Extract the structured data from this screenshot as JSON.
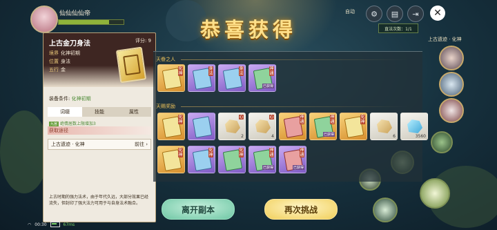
{
  "player": {
    "name": "仙仙仙仙帝",
    "hp_fraction": 0.78
  },
  "title": "恭喜获得",
  "topbar": {
    "auto": "自动",
    "speed": "直法次数：1/1",
    "location": "上古遗迹 · 化神"
  },
  "card": {
    "name": "上古金刀身法",
    "score": "评分: 9",
    "attributes": [
      {
        "key": "境界",
        "value": "化神初期"
      },
      {
        "key": "位置",
        "value": "身法"
      },
      {
        "key": "五行",
        "value": "金"
      }
    ],
    "equip_label": "装备条件:",
    "equip_value": "化神初期",
    "tabs": [
      "词缀",
      "技能",
      "属性"
    ],
    "bonus_tag": "九宫",
    "bonus_text": "绝情居数上限增加3",
    "obtain_label": "获取途径",
    "obtain_source": "上古遗迹 · 化神",
    "obtain_action": "前往",
    "description": "上古时期的强力法术，由于年代久远，大部分效果已经流失，但封印了强大法力可用于与自身法术融合。"
  },
  "rewards": {
    "section1": "天眷之人",
    "section2": "天赐奖励",
    "row1": [
      {
        "color": "gold",
        "book": "g",
        "tag": "化神",
        "count": ""
      },
      {
        "color": "purple",
        "book": "p",
        "tag": "身法",
        "count": ""
      },
      {
        "color": "purple",
        "book": "p",
        "tag": "身法",
        "count": ""
      },
      {
        "color": "purple",
        "book": "gr",
        "tag": "神通",
        "tag2": "已获得",
        "count": ""
      }
    ],
    "row2": [
      {
        "color": "gold",
        "book": "g",
        "tag": "化神",
        "count": ""
      },
      {
        "color": "purple",
        "book": "p",
        "tag": "",
        "count": ""
      },
      {
        "color": "white",
        "book": "",
        "tag": "心",
        "count": "2"
      },
      {
        "color": "white",
        "book": "",
        "tag": "心",
        "count": "4"
      },
      {
        "color": "gold",
        "book": "r",
        "tag": "神通",
        "count": ""
      },
      {
        "color": "gold",
        "book": "gr",
        "tag": "神通",
        "tag2": "已获得",
        "count": ""
      },
      {
        "color": "gold",
        "book": "g",
        "tag": "化神",
        "count": ""
      },
      {
        "color": "white",
        "book": "",
        "tag": "",
        "count": "6"
      },
      {
        "color": "white",
        "book": "",
        "tag": "",
        "count": "3560"
      }
    ],
    "row3": [
      {
        "color": "gold",
        "book": "g",
        "tag": "化神",
        "count": ""
      },
      {
        "color": "purple",
        "book": "p",
        "tag": "化神",
        "count": ""
      },
      {
        "color": "purple",
        "book": "gr",
        "tag": "化神",
        "count": ""
      },
      {
        "color": "purple",
        "book": "gr",
        "tag": "神通",
        "tag2": "已获得",
        "count": ""
      },
      {
        "color": "purple",
        "book": "r",
        "tag": "神通",
        "tag2": "已获得",
        "count": ""
      }
    ]
  },
  "buttons": {
    "leave": "离开副本",
    "again": "再次挑战"
  },
  "status": {
    "time": "00:30",
    "latency": "67ms"
  },
  "icons": {
    "close": "close-icon",
    "settings": "gear-icon",
    "exit": "exit-icon",
    "chart": "chart-icon"
  }
}
